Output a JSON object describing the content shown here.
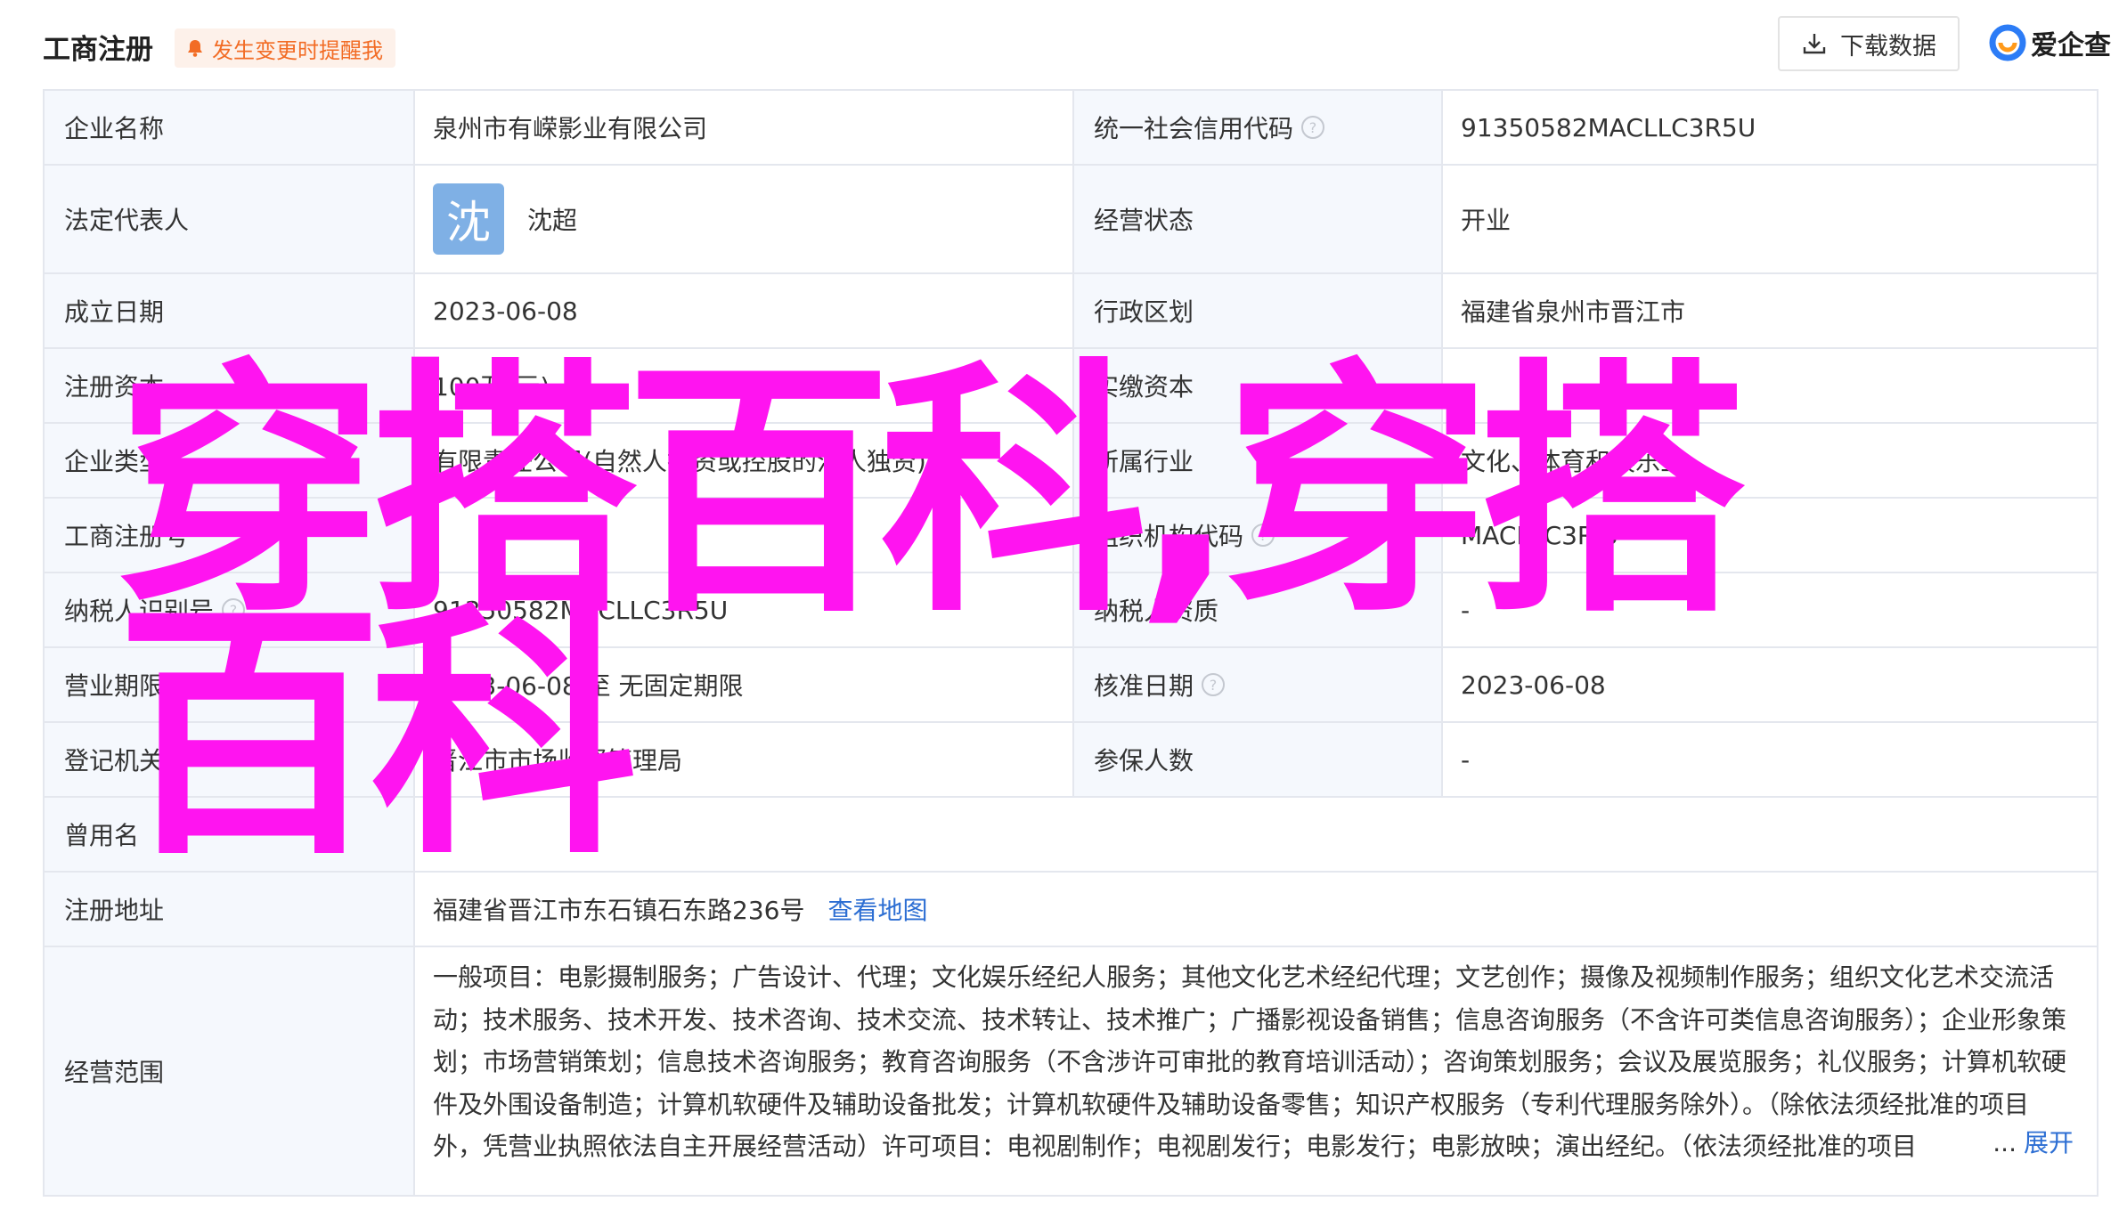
{
  "header": {
    "title": "工商注册",
    "alert_tag": "发生变更时提醒我",
    "download_button": "下载数据",
    "brand": "爱企查"
  },
  "colors": {
    "accent_orange": "#f26c25",
    "link_blue": "#2c6ed3",
    "label_bg": "#f5f8fd",
    "avatar_bg": "#7fb0e5",
    "watermark": "#ff14f0"
  },
  "rows": {
    "name": {
      "label": "企业名称",
      "value": "泉州市有嵘影业有限公司",
      "label2": "统一社会信用代码",
      "value2": "91350582MACLLC3R5U"
    },
    "legal": {
      "label": "法定代表人",
      "avatar_char": "沈",
      "value": "沈超",
      "label2": "经营状态",
      "value2": "开业"
    },
    "founded": {
      "label": "成立日期",
      "value": "2023-06-08",
      "label2": "行政区划",
      "value2": "福建省泉州市晋江市"
    },
    "capital": {
      "label": "注册资本",
      "value": "100万(元)",
      "label2": "实缴资本",
      "value2": "-"
    },
    "type": {
      "label": "企业类型",
      "value": "有限责任公司(自然人投资或控股的法人独资)",
      "label2": "所属行业",
      "value2": "文化、体育和娱乐业"
    },
    "reg_no": {
      "label": "工商注册号",
      "value": "",
      "label2": "组织机构代码",
      "value2": "MACLLC3R-5"
    },
    "tax_id": {
      "label": "纳税人识别号",
      "value": "91350582MACLLC3R5U",
      "label2": "纳税人资质",
      "value2": "-"
    },
    "term": {
      "label": "营业期限",
      "value": "2023-06-08 至 无固定期限",
      "label2": "核准日期",
      "value2": "2023-06-08"
    },
    "authority": {
      "label": "登记机关",
      "value": "晋江市市场监督管理局",
      "label2": "参保人数",
      "value2": "-"
    },
    "former_name": {
      "label": "曾用名",
      "value": "-"
    },
    "address": {
      "label": "注册地址",
      "value": "福建省晋江市东石镇石东路236号",
      "link": "查看地图"
    },
    "scope": {
      "label": "经营范围",
      "value": "一般项目：电影摄制服务；广告设计、代理；文化娱乐经纪人服务；其他文化艺术经纪代理；文艺创作；摄像及视频制作服务；组织文化艺术交流活动；技术服务、技术开发、技术咨询、技术交流、技术转让、技术推广；广播影视设备销售；信息咨询服务（不含许可类信息咨询服务）；企业形象策划；市场营销策划；信息技术咨询服务；教育咨询服务（不含涉许可审批的教育培训活动）；咨询策划服务；会议及展览服务；礼仪服务；计算机软硬件及外围设备制造；计算机软硬件及辅助设备批发；计算机软硬件及辅助设备零售；知识产权服务（专利代理服务除外）。（除依法须经批准的项目外，凭营业执照依法自主开展经营活动）许可项目：电视剧制作；电视剧发行；电影发行；电影放映；演出经纪。（依法须经批准的项目",
      "ellipsis": "...",
      "expand": "展开"
    }
  },
  "watermark": "穿搭百科,穿搭百科"
}
